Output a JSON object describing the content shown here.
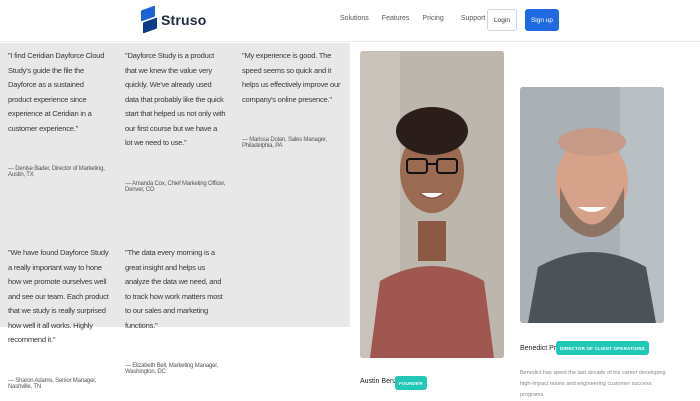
{
  "header": {
    "logo_text": "Struso",
    "nav": [
      "Solutions",
      "Features",
      "Pricing",
      "Support"
    ],
    "login_label": "Login",
    "signup_label": "Sign up"
  },
  "testimonials": [
    {
      "quote": "\"I find Ceridian Dayforce Cloud Study's guide the file the Dayforce as a sustained product experience since experience at Ceridian in a customer experience.\"",
      "author": "— Denise Bader, Director of Marketing, Austin, TX"
    },
    {
      "quote": "\"Dayforce Study is a product that we knew the value very quickly. We've already used data that probably like the quick start that helped us not only with our first course but we have a lot we need to use.\"",
      "author": "— Amanda Cox, Chief Marketing Officer, Denver, CO"
    },
    {
      "quote": "\"My experience is good. The speed seems so quick and it helps us effectively improve our company's online presence.\"",
      "author": "— Marissa Dolan, Sales Manager, Philadelphia, PA"
    },
    {
      "quote": "\"We have found Dayforce Study a really important way to hone how we promote ourselves well and see our team. Each product that we study is really surprised how well it all works. Highly recommend it.\"",
      "author": "— Sharon Adams, Senior Manager, Nashville, TN"
    },
    {
      "quote": "\"The data every morning is a great insight and helps us analyze the data we need, and to track how work matters most to our sales and marketing functions.\"",
      "author": "— Elizabeth Bell, Marketing Manager, Washington, DC"
    }
  ],
  "team": [
    {
      "name": "Austin Benzer",
      "role": "FOUNDER"
    },
    {
      "name": "Benedict Price",
      "role": "DIRECTOR OF CLIENT OPERATIONS",
      "bio": "Benedict has spent the last decade of his career developing high-impact teams and engineering customer success programs."
    }
  ],
  "colors": {
    "brand_blue": "#1f69e0",
    "badge_teal": "#21c8b7",
    "panel_gray": "#e8e8e8"
  }
}
